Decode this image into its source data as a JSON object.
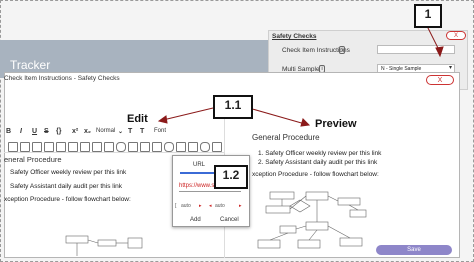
{
  "background": {
    "title": "Tracker"
  },
  "side_panel": {
    "title": "Safety Checks",
    "close_label": "X",
    "row1_label": "Check Item Instructions",
    "row1_info": "i",
    "row2_label": "Multi Sample",
    "row2_info": "i",
    "row2_value": "N - Single Sample"
  },
  "modal": {
    "title": "Check Item Instructions - Safety Checks",
    "close_label": "X",
    "save_label": "Save"
  },
  "toolbar": {
    "bold": "B",
    "italic": "I",
    "underline": "U",
    "strike": "S",
    "code": "{}",
    "superscript": "x²",
    "subscript": "x₂",
    "style": "Normal",
    "font": "Font"
  },
  "editor": {
    "heading": "eneral Procedure",
    "line1": "Safety Officer weekly review per this link",
    "line2": "Safety Assistant daily audit per this link",
    "line3": "xception Procedure - follow flowchart below:"
  },
  "preview": {
    "heading": "General Procedure",
    "item1": "1. Safety Officer weekly review per this link",
    "item2": "2. Safety Assistant daily audit per this link",
    "line3": "xception Procedure - follow flowchart below:"
  },
  "url_popup": {
    "tab": "URL",
    "value": "https://www.someurl.com",
    "size_left": "auto",
    "size_right": "auto",
    "add_label": "Add",
    "cancel_label": "Cancel"
  },
  "annotations": {
    "callout_1": "1",
    "callout_11": "1.1",
    "callout_12": "1.2",
    "edit": "Edit",
    "preview": "Preview"
  }
}
